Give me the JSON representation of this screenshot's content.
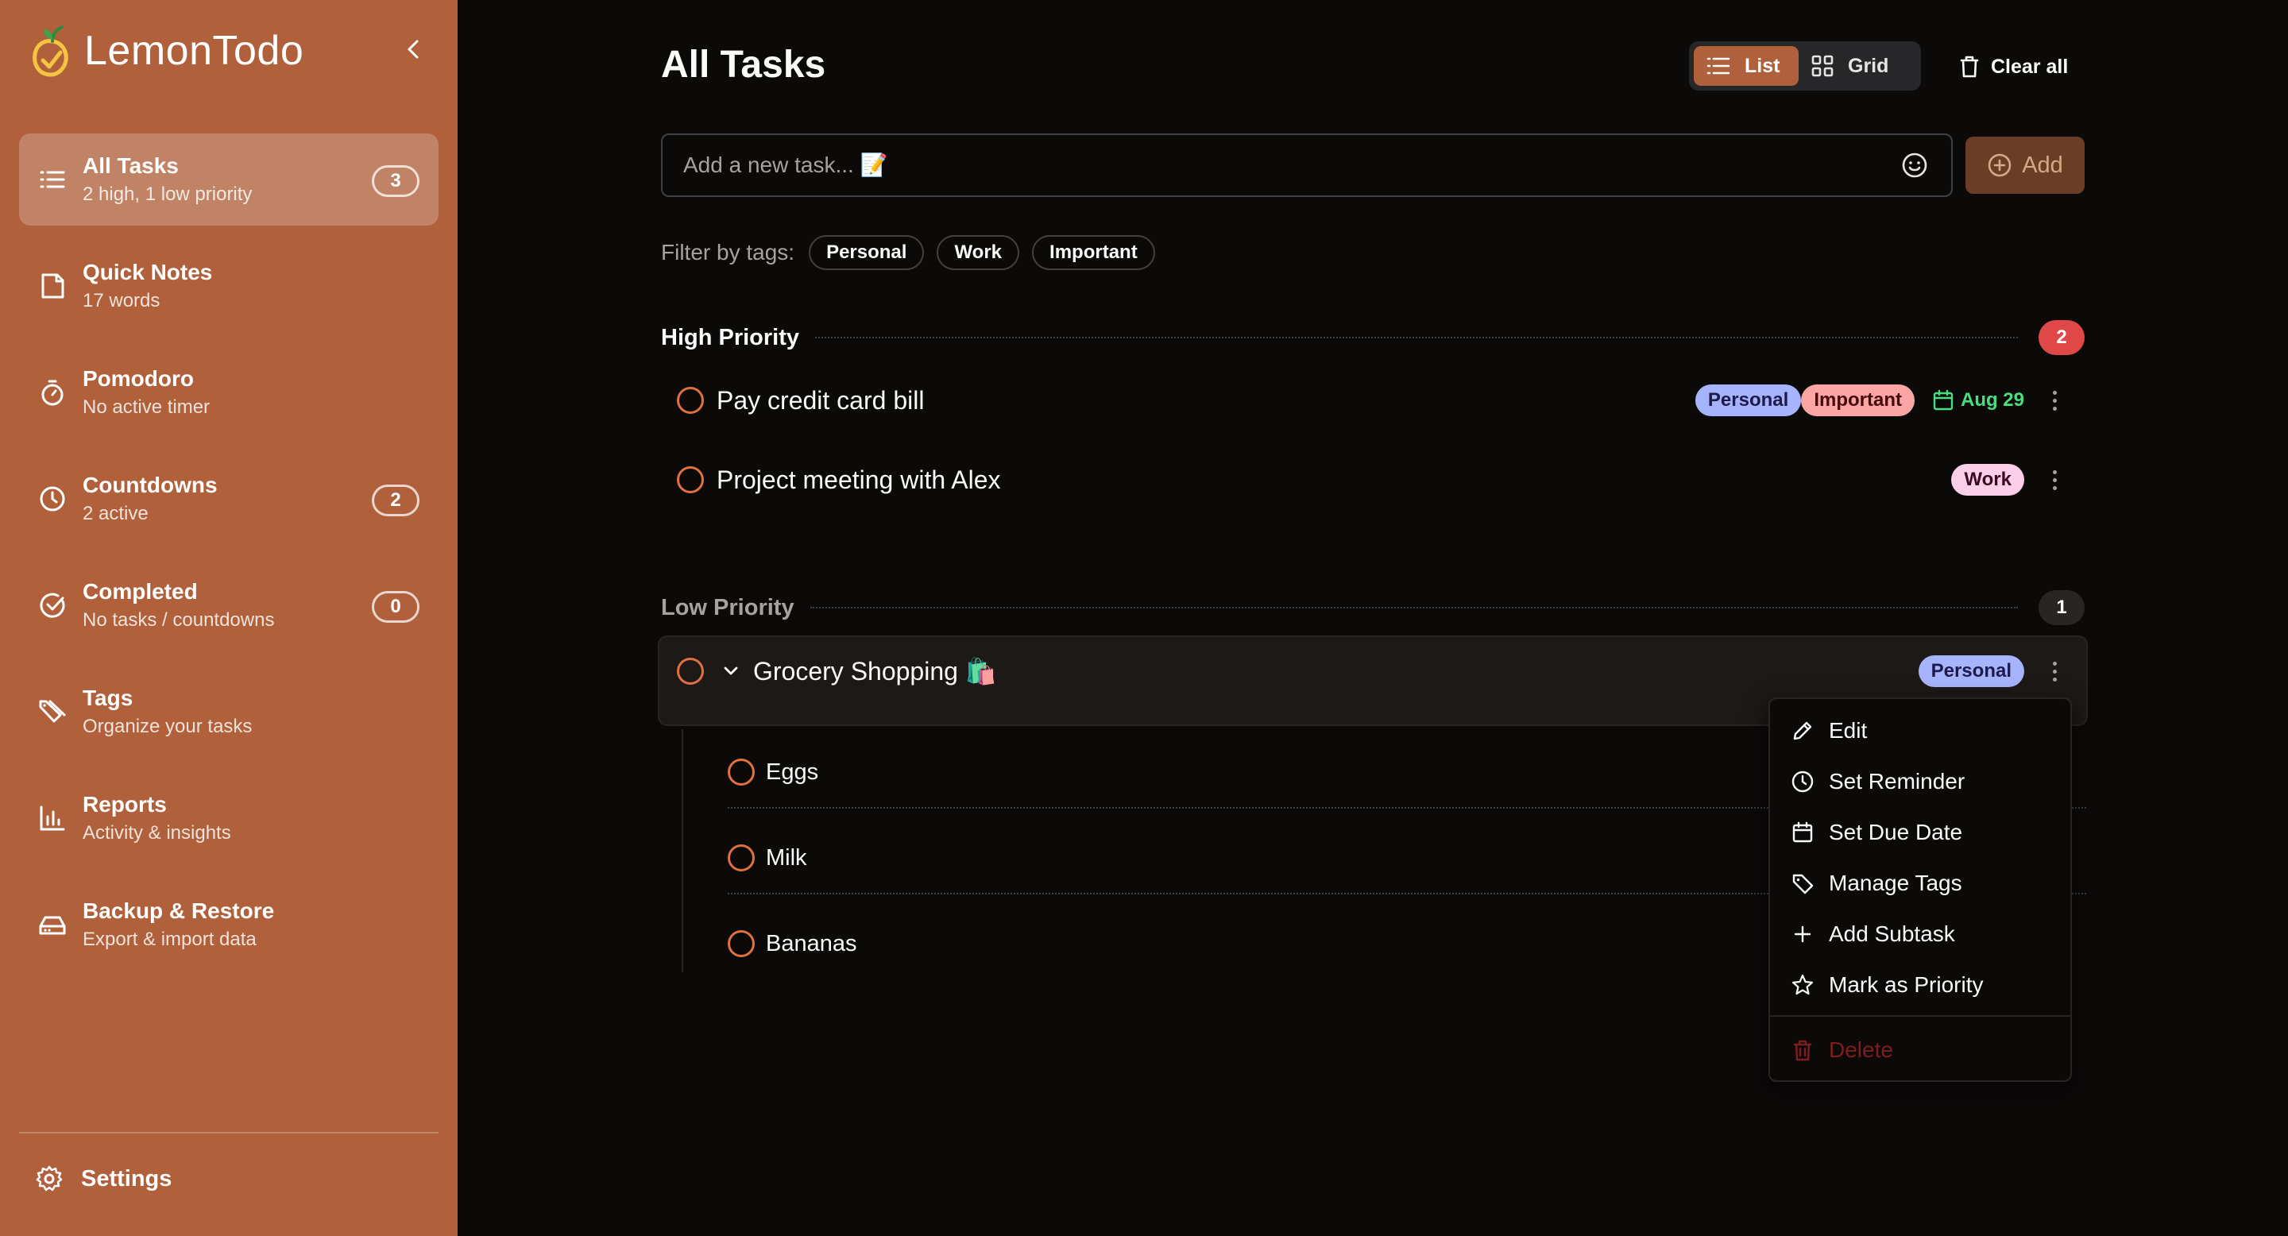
{
  "app": {
    "name": "LemonTodo"
  },
  "sidebar": {
    "items": [
      {
        "title": "All Tasks",
        "subtitle": "2 high, 1 low priority",
        "badge": "3",
        "icon": "list-icon",
        "active": true
      },
      {
        "title": "Quick Notes",
        "subtitle": "17 words",
        "badge": "",
        "icon": "note-icon"
      },
      {
        "title": "Pomodoro",
        "subtitle": "No active timer",
        "badge": "",
        "icon": "timer-icon"
      },
      {
        "title": "Countdowns",
        "subtitle": "2 active",
        "badge": "2",
        "icon": "clock-icon"
      },
      {
        "title": "Completed",
        "subtitle": "No tasks / countdowns",
        "badge": "0",
        "icon": "check-circle-icon"
      },
      {
        "title": "Tags",
        "subtitle": "Organize your tasks",
        "badge": "",
        "icon": "tag-icon"
      },
      {
        "title": "Reports",
        "subtitle": "Activity & insights",
        "badge": "",
        "icon": "bar-chart-icon"
      },
      {
        "title": "Backup & Restore",
        "subtitle": "Export & import data",
        "badge": "",
        "icon": "drive-icon"
      }
    ],
    "settings_label": "Settings"
  },
  "header": {
    "title": "All Tasks",
    "view_list_label": "List",
    "view_grid_label": "Grid",
    "clear_all_label": "Clear all"
  },
  "new_task": {
    "placeholder": "Add a new task... 📝",
    "add_label": "Add"
  },
  "filter": {
    "label": "Filter by tags:",
    "tags": [
      "Personal",
      "Work",
      "Important"
    ]
  },
  "sections": {
    "high": {
      "title": "High Priority",
      "count": "2",
      "tasks": [
        {
          "title": "Pay credit card bill",
          "tags": [
            "Personal",
            "Important"
          ],
          "due": "Aug 29"
        },
        {
          "title": "Project meeting with Alex",
          "tags": [
            "Work"
          ]
        }
      ]
    },
    "low": {
      "title": "Low Priority",
      "count": "1",
      "tasks": [
        {
          "title": "Grocery Shopping 🛍️",
          "tags": [
            "Personal"
          ],
          "subtasks": [
            "Eggs",
            "Milk",
            "Bananas"
          ]
        }
      ]
    }
  },
  "context_menu": {
    "items": [
      "Edit",
      "Set Reminder",
      "Set Due Date",
      "Manage Tags",
      "Add Subtask",
      "Mark as Priority"
    ],
    "delete_label": "Delete"
  },
  "colors": {
    "sidebar_bg": "#b0603a",
    "accent": "#b0603a",
    "background": "#0c0a09",
    "high_badge": "#e04848",
    "due_green": "#4ade80"
  }
}
